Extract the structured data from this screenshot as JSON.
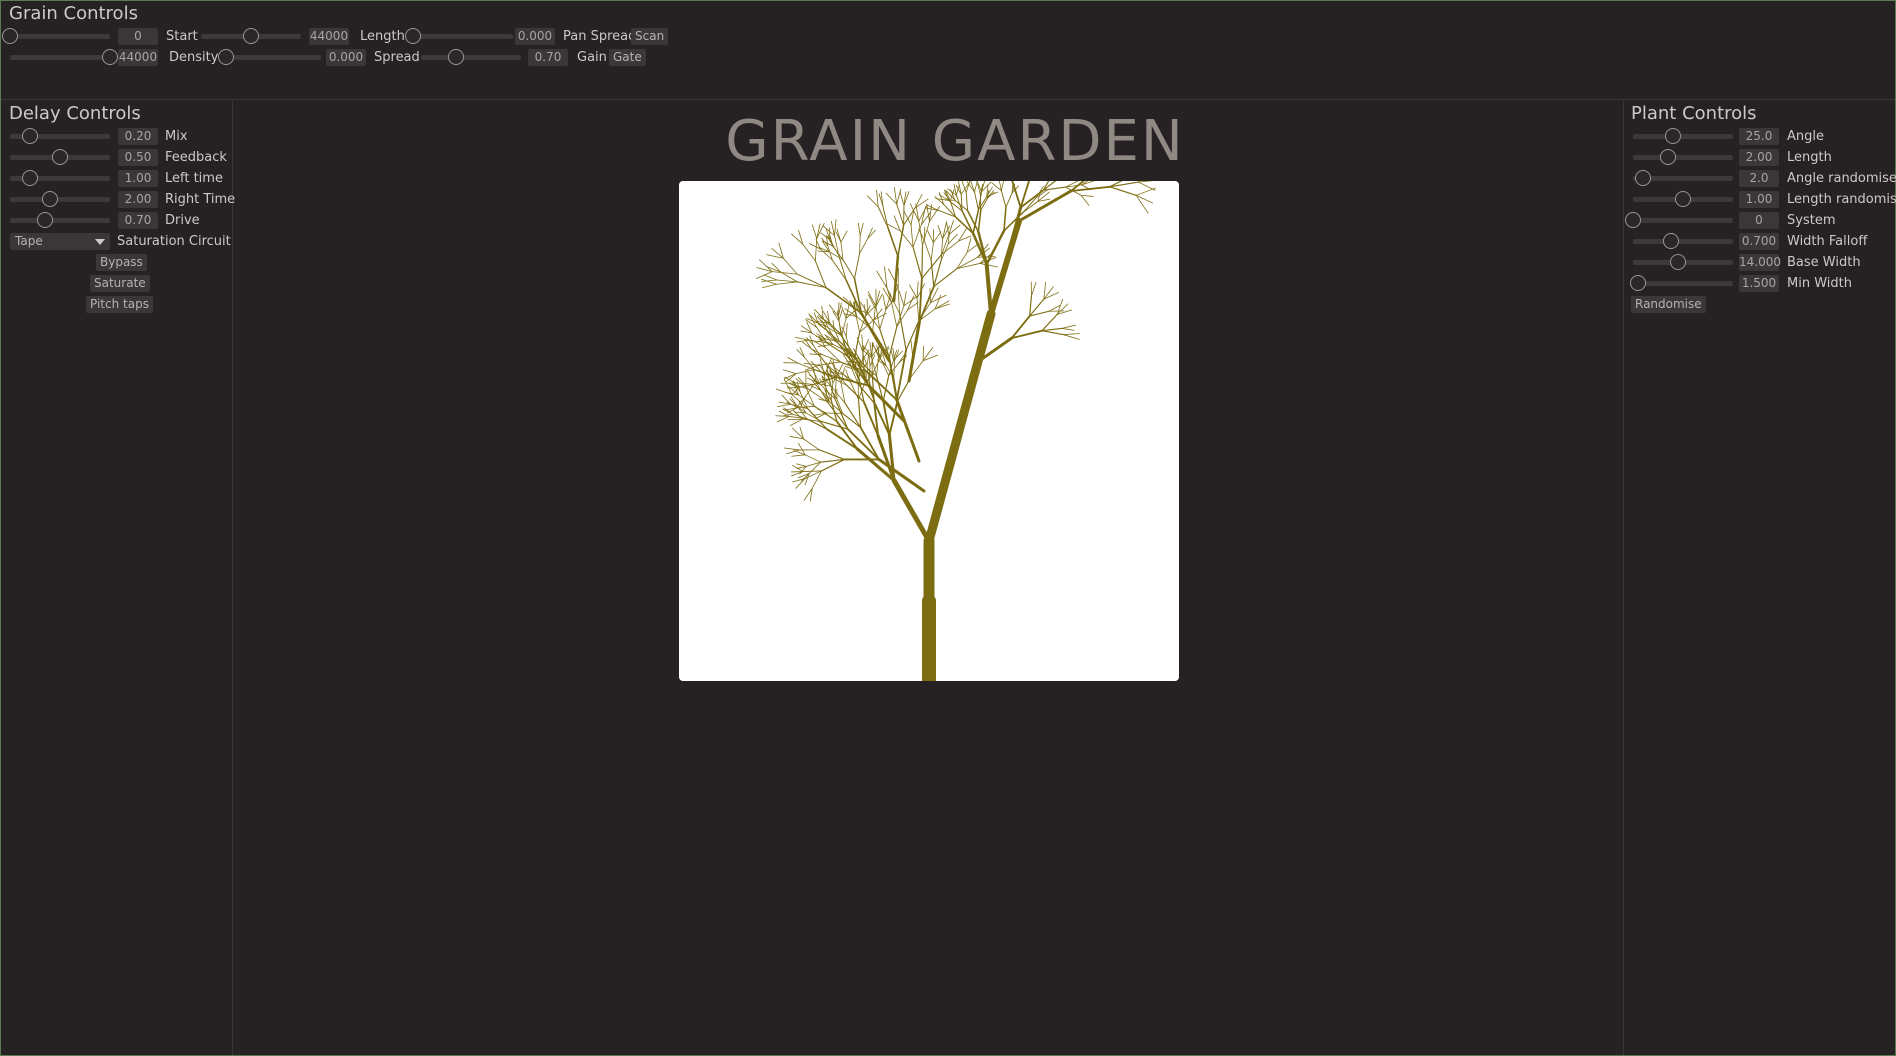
{
  "grain": {
    "title": "Grain Controls",
    "row1": {
      "start": {
        "value": "0",
        "label": "Start",
        "level": 0.0
      },
      "length": {
        "value": "44000",
        "label": "Length",
        "level": 0.5
      },
      "pan_spread": {
        "value": "0.000",
        "label": "Pan Spread",
        "level": 0.0
      },
      "scan_button": "Scan"
    },
    "row2": {
      "density": {
        "value": "44000",
        "label": "Density",
        "level": 1.0
      },
      "spread": {
        "value": "0.000",
        "label": "Spread",
        "level": 0.0
      },
      "gain": {
        "value": "0.70",
        "label": "Gain",
        "level": 0.35
      },
      "gate_button": "Gate"
    }
  },
  "delay": {
    "title": "Delay Controls",
    "mix": {
      "value": "0.20",
      "label": "Mix",
      "level": 0.2
    },
    "feedback": {
      "value": "0.50",
      "label": "Feedback",
      "level": 0.5
    },
    "left_time": {
      "value": "1.00",
      "label": "Left time",
      "level": 0.2
    },
    "right_time": {
      "value": "2.00",
      "label": "Right Time",
      "level": 0.4
    },
    "drive": {
      "value": "0.70",
      "label": "Drive",
      "level": 0.35
    },
    "saturation_circuit": {
      "value": "Tape",
      "label": "Saturation Circuit"
    },
    "bypass_button": "Bypass",
    "saturate_button": "Saturate",
    "pitch_taps_button": "Pitch taps"
  },
  "plant": {
    "title": "Plant Controls",
    "angle": {
      "value": "25.0",
      "label": "Angle",
      "level": 0.4
    },
    "length": {
      "value": "2.00",
      "label": "Length",
      "level": 0.35
    },
    "angle_randomise": {
      "value": "2.0",
      "label": "Angle randomise",
      "level": 0.1
    },
    "length_randomise": {
      "value": "1.00",
      "label": "Length randomise",
      "level": 0.5
    },
    "system": {
      "value": "0",
      "label": "System",
      "level": 0.0
    },
    "width_falloff": {
      "value": "0.700",
      "label": "Width Falloff",
      "level": 0.38
    },
    "base_width": {
      "value": "14.000",
      "label": "Base Width",
      "level": 0.45
    },
    "min_width": {
      "value": "1.500",
      "label": "Min Width",
      "level": 0.05
    },
    "randomise_button": "Randomise"
  },
  "header": {
    "logo_text": "GRAIN GARDEN"
  },
  "colors": {
    "background": "#262224",
    "plant": "#7d6d12",
    "canvas": "#ffffff",
    "logo": "#8f8883"
  }
}
